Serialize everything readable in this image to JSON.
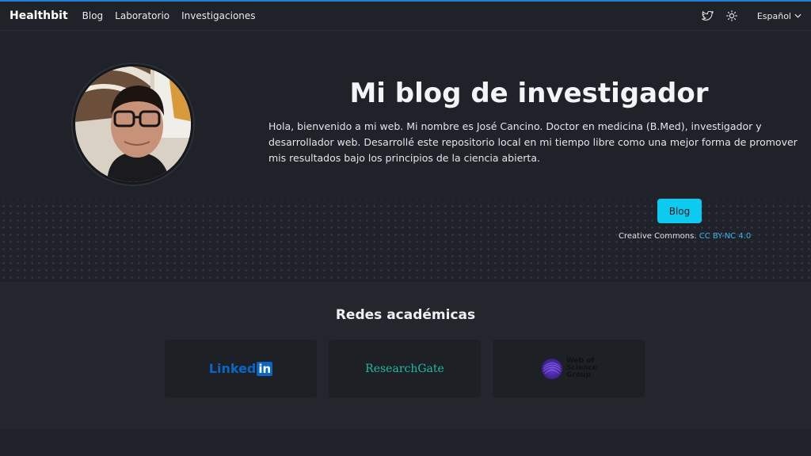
{
  "colors": {
    "background": "#1f2329",
    "accent": "#0dcaf0",
    "link": "#3fb4f0",
    "linkedin": "#0a66c2",
    "researchgate": "#22b8a5"
  },
  "nav": {
    "brand": "Healthbit",
    "links": [
      "Blog",
      "Laboratorio",
      "Investigaciones"
    ],
    "icons": [
      "twitter-icon",
      "sun-icon"
    ],
    "language": "Español"
  },
  "hero": {
    "title": "Mi blog de investigador",
    "text": "Hola, bienvenido a mi web. Mi nombre es José Cancino. Doctor en medicina (B.Med), investigador y desarrollador web. Desarrollé este repositorio local en mi tiempo libre como una mejor forma de promover mis resultados bajo los principios de la ciencia abierta.",
    "button": "Blog",
    "license_prefix": "Creative Commons.",
    "license_link": "CC BY-NC 4.0"
  },
  "academic": {
    "title": "Redes académicas",
    "cards": [
      {
        "name": "Linked",
        "suffix": "in"
      },
      {
        "name": "ResearchGate"
      },
      {
        "name": "Web of Science Group",
        "lines": [
          "Web of",
          "Science",
          "Group"
        ]
      }
    ]
  }
}
